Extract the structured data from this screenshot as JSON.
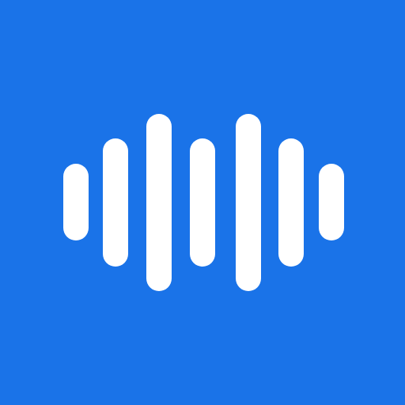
{
  "icon": {
    "name": "sound-wave-icon",
    "background_color": "#1a73e8",
    "bar_color": "#ffffff",
    "bar_count": 7
  }
}
